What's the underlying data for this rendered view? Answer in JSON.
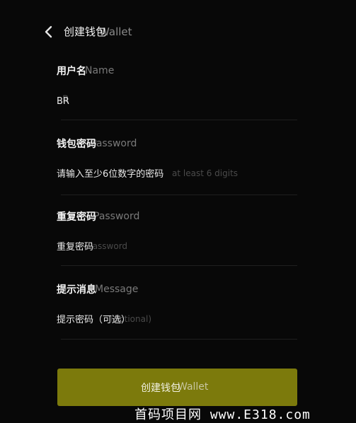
{
  "header": {
    "back_icon": "chevron-left-icon",
    "title": "创建钱包",
    "title_ghost": "Wallet"
  },
  "fields": {
    "name": {
      "label": "用户名",
      "label_ghost": "Name",
      "value": "BR",
      "value_ghost": "R"
    },
    "password": {
      "label": "钱包密码",
      "label_ghost": "Password",
      "placeholder": "请输入至少6位数字的密码",
      "placeholder_ghost": "at least 6 digits"
    },
    "repeat": {
      "label": "重复密码",
      "label_ghost": "Password",
      "placeholder": "重复密码",
      "placeholder_ghost": "Password"
    },
    "hint": {
      "label": "提示消息",
      "label_ghost": "Message",
      "placeholder": "提示密码（可选）",
      "placeholder_ghost": "(optional)"
    }
  },
  "button": {
    "label": "创建钱包",
    "label_ghost": "Wallet",
    "color": "#7c7a0c"
  },
  "watermark": "首码项目网 www.E318.com"
}
